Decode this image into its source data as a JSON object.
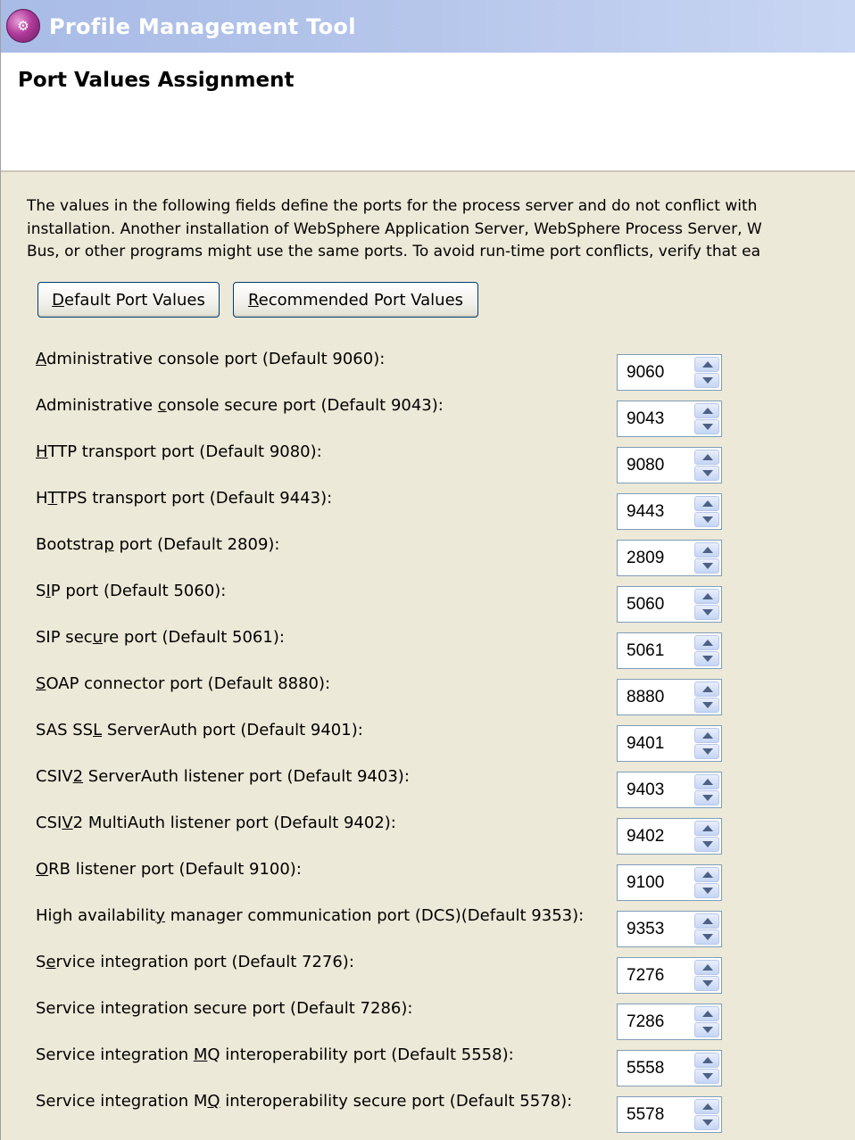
{
  "window": {
    "title": "Profile Management Tool",
    "icon": "profile-tool-icon"
  },
  "page": {
    "title": "Port Values Assignment",
    "intro_lines": [
      "The values in the following fields define the ports for the process server and do not conflict with",
      "installation. Another installation of WebSphere Application Server, WebSphere Process Server, W",
      "Bus, or other programs might use the same ports. To avoid run-time port conflicts, verify that ea"
    ]
  },
  "buttons": {
    "default_ports": {
      "mnemonic": "D",
      "rest": "efault Port Values"
    },
    "recommended_ports": {
      "mnemonic": "R",
      "rest": "ecommended Port Values"
    }
  },
  "ports": [
    {
      "pre": "",
      "key": "A",
      "post": "dministrative console port (Default 9060):",
      "value": "9060"
    },
    {
      "pre": "Administrative ",
      "key": "c",
      "post": "onsole secure port (Default 9043):",
      "value": "9043"
    },
    {
      "pre": "",
      "key": "H",
      "post": "TTP transport port (Default 9080):",
      "value": "9080"
    },
    {
      "pre": "H",
      "key": "T",
      "post": "TPS transport port (Default 9443):",
      "value": "9443"
    },
    {
      "pre": "Bootstra",
      "key": "p",
      "post": " port (Default 2809):",
      "value": "2809"
    },
    {
      "pre": "S",
      "key": "I",
      "post": "P port (Default 5060):",
      "value": "5060"
    },
    {
      "pre": "SIP sec",
      "key": "u",
      "post": "re port (Default 5061):",
      "value": "5061"
    },
    {
      "pre": "",
      "key": "S",
      "post": "OAP connector port (Default 8880):",
      "value": "8880"
    },
    {
      "pre": "SAS SS",
      "key": "L",
      "post": " ServerAuth port (Default 9401):",
      "value": "9401"
    },
    {
      "pre": "CSIV",
      "key": "2",
      "post": " ServerAuth listener port (Default 9403):",
      "value": "9403"
    },
    {
      "pre": "CSI",
      "key": "V",
      "post": "2 MultiAuth listener port (Default 9402):",
      "value": "9402"
    },
    {
      "pre": "",
      "key": "O",
      "post": "RB listener port (Default 9100):",
      "value": "9100"
    },
    {
      "pre": "High availabilit",
      "key": "y",
      "post": " manager communication port (DCS)(Default 9353):",
      "value": "9353"
    },
    {
      "pre": "S",
      "key": "e",
      "post": "rvice integration port (Default 7276):",
      "value": "7276"
    },
    {
      "pre": "Service inte",
      "key": "g",
      "post": "ration secure port (Default 7286):",
      "value": "7286"
    },
    {
      "pre": "Service integration ",
      "key": "M",
      "post": "Q interoperability port (Default 5558):",
      "value": "5558"
    },
    {
      "pre": "Service integration M",
      "key": "Q",
      "post": " interoperability secure port (Default 5578):",
      "value": "5578"
    }
  ]
}
